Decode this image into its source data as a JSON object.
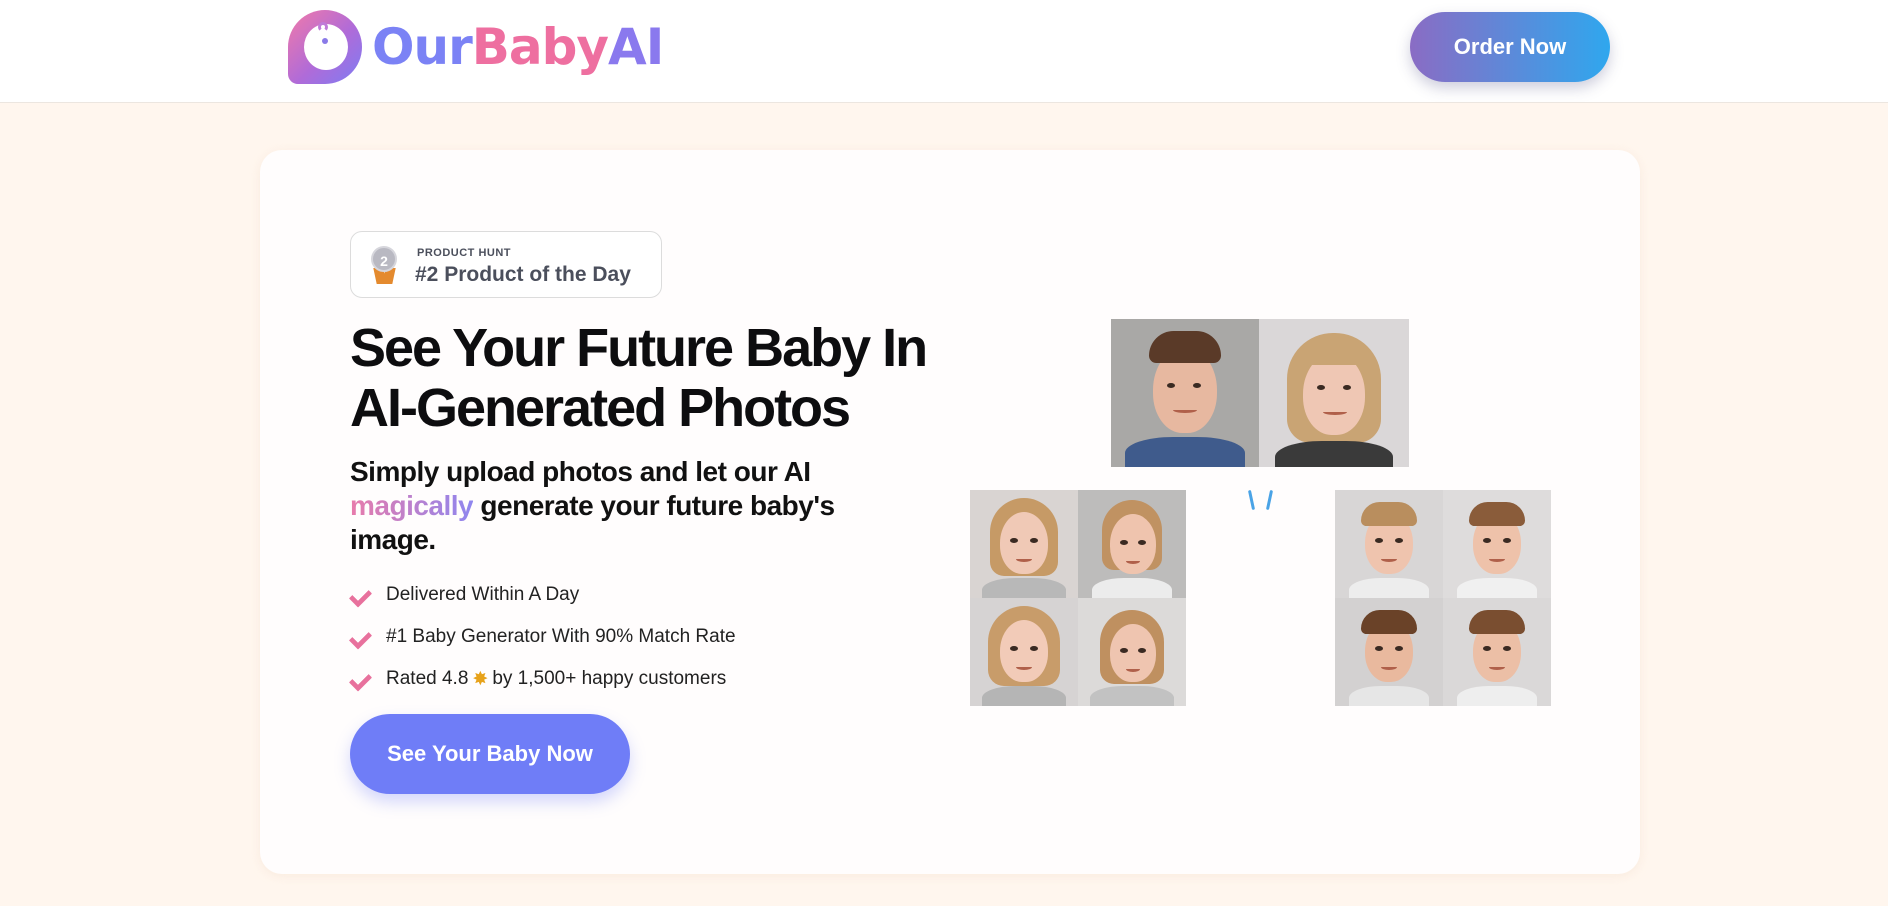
{
  "header": {
    "logo": {
      "part1": "Our",
      "part2": "Baby",
      "part3": "AI"
    },
    "order_label": "Order Now"
  },
  "hero": {
    "badge": {
      "kicker": "PRODUCT HUNT",
      "title": "#2 Product of the Day",
      "medal_number": "2"
    },
    "headline_line1": "See Your Future Baby In",
    "headline_line2": "AI-Generated Photos",
    "subtitle_before": "Simply upload photos and let our AI ",
    "subtitle_accent": "magically",
    "subtitle_after": " generate your future baby's image.",
    "features": [
      {
        "text": "Delivered Within A Day"
      },
      {
        "text": "#1 Baby Generator With 90% Match Rate"
      },
      {
        "text_before": "Rated 4.8",
        "icon": "star-icon",
        "text_after": "by 1,500+ happy customers"
      }
    ],
    "cta_label": "See Your Baby Now"
  },
  "colors": {
    "page_bg": "#fff6ee",
    "accent_pink": "#e8719d",
    "cta_blue": "#6f7df7",
    "order_gradient_start": "#8a6cc4",
    "order_gradient_end": "#2fa7ee"
  }
}
